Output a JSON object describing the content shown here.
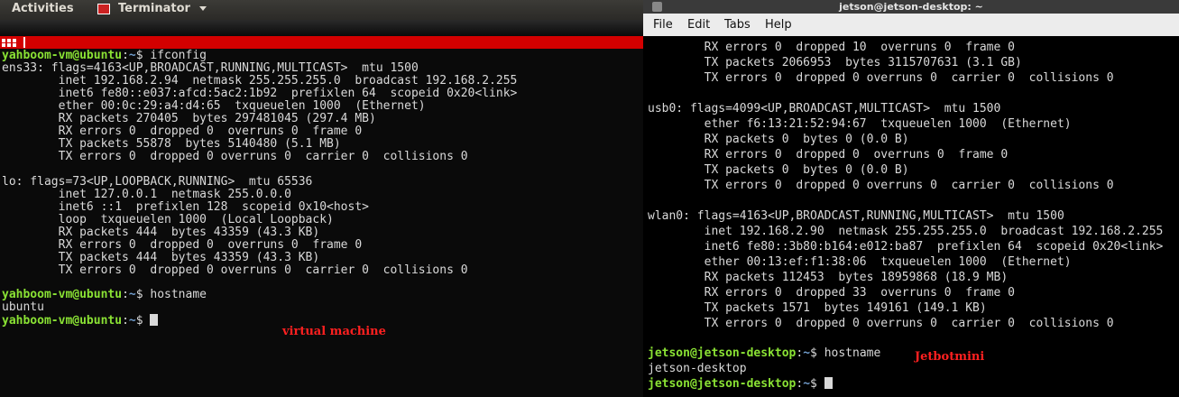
{
  "left": {
    "topbar": {
      "activities": "Activities",
      "app": "Terminator"
    },
    "output": "ens33: flags=4163<UP,BROADCAST,RUNNING,MULTICAST>  mtu 1500\n        inet 192.168.2.94  netmask 255.255.255.0  broadcast 192.168.2.255\n        inet6 fe80::e037:afcd:5ac2:1b92  prefixlen 64  scopeid 0x20<link>\n        ether 00:0c:29:a4:d4:65  txqueuelen 1000  (Ethernet)\n        RX packets 270405  bytes 297481045 (297.4 MB)\n        RX errors 0  dropped 0  overruns 0  frame 0\n        TX packets 55878  bytes 5140480 (5.1 MB)\n        TX errors 0  dropped 0 overruns 0  carrier 0  collisions 0\n\nlo: flags=73<UP,LOOPBACK,RUNNING>  mtu 65536\n        inet 127.0.0.1  netmask 255.0.0.0\n        inet6 ::1  prefixlen 128  scopeid 0x10<host>\n        loop  txqueuelen 1000  (Local Loopback)\n        RX packets 444  bytes 43359 (43.3 KB)\n        RX errors 0  dropped 0  overruns 0  frame 0\n        TX packets 444  bytes 43359 (43.3 KB)\n        TX errors 0  dropped 0 overruns 0  carrier 0  collisions 0",
    "user": "yahboom-vm@ubuntu",
    "colon": ":",
    "path": "~",
    "prompt_sym": "$ ",
    "cmd1": "ifconfig",
    "cmd2": "hostname",
    "hostname_out": "ubuntu",
    "annotation": "virtual machine"
  },
  "right": {
    "title": "jetson@jetson-desktop: ~",
    "menu": [
      "File",
      "Edit",
      "Tabs",
      "Help"
    ],
    "output": "        RX errors 0  dropped 10  overruns 0  frame 0\n        TX packets 2066953  bytes 3115707631 (3.1 GB)\n        TX errors 0  dropped 0 overruns 0  carrier 0  collisions 0\n\nusb0: flags=4099<UP,BROADCAST,MULTICAST>  mtu 1500\n        ether f6:13:21:52:94:67  txqueuelen 1000  (Ethernet)\n        RX packets 0  bytes 0 (0.0 B)\n        RX errors 0  dropped 0  overruns 0  frame 0\n        TX packets 0  bytes 0 (0.0 B)\n        TX errors 0  dropped 0 overruns 0  carrier 0  collisions 0\n\nwlan0: flags=4163<UP,BROADCAST,RUNNING,MULTICAST>  mtu 1500\n        inet 192.168.2.90  netmask 255.255.255.0  broadcast 192.168.2.255\n        inet6 fe80::3b80:b164:e012:ba87  prefixlen 64  scopeid 0x20<link>\n        ether 00:13:ef:f1:38:06  txqueuelen 1000  (Ethernet)\n        RX packets 112453  bytes 18959868 (18.9 MB)\n        RX errors 0  dropped 33  overruns 0  frame 0\n        TX packets 1571  bytes 149161 (149.1 KB)\n        TX errors 0  dropped 0 overruns 0  carrier 0  collisions 0",
    "user": "jetson@jetson-desktop",
    "colon": ":",
    "path": "~",
    "prompt_sym": "$ ",
    "cmd": "hostname",
    "hostname_out": "jetson-desktop",
    "annotation": "Jetbotmini"
  },
  "colors": {
    "prompt_user": "#8ae234",
    "prompt_path": "#729fcf",
    "annotation": "#ff2020",
    "tab_bar": "#d30000"
  }
}
